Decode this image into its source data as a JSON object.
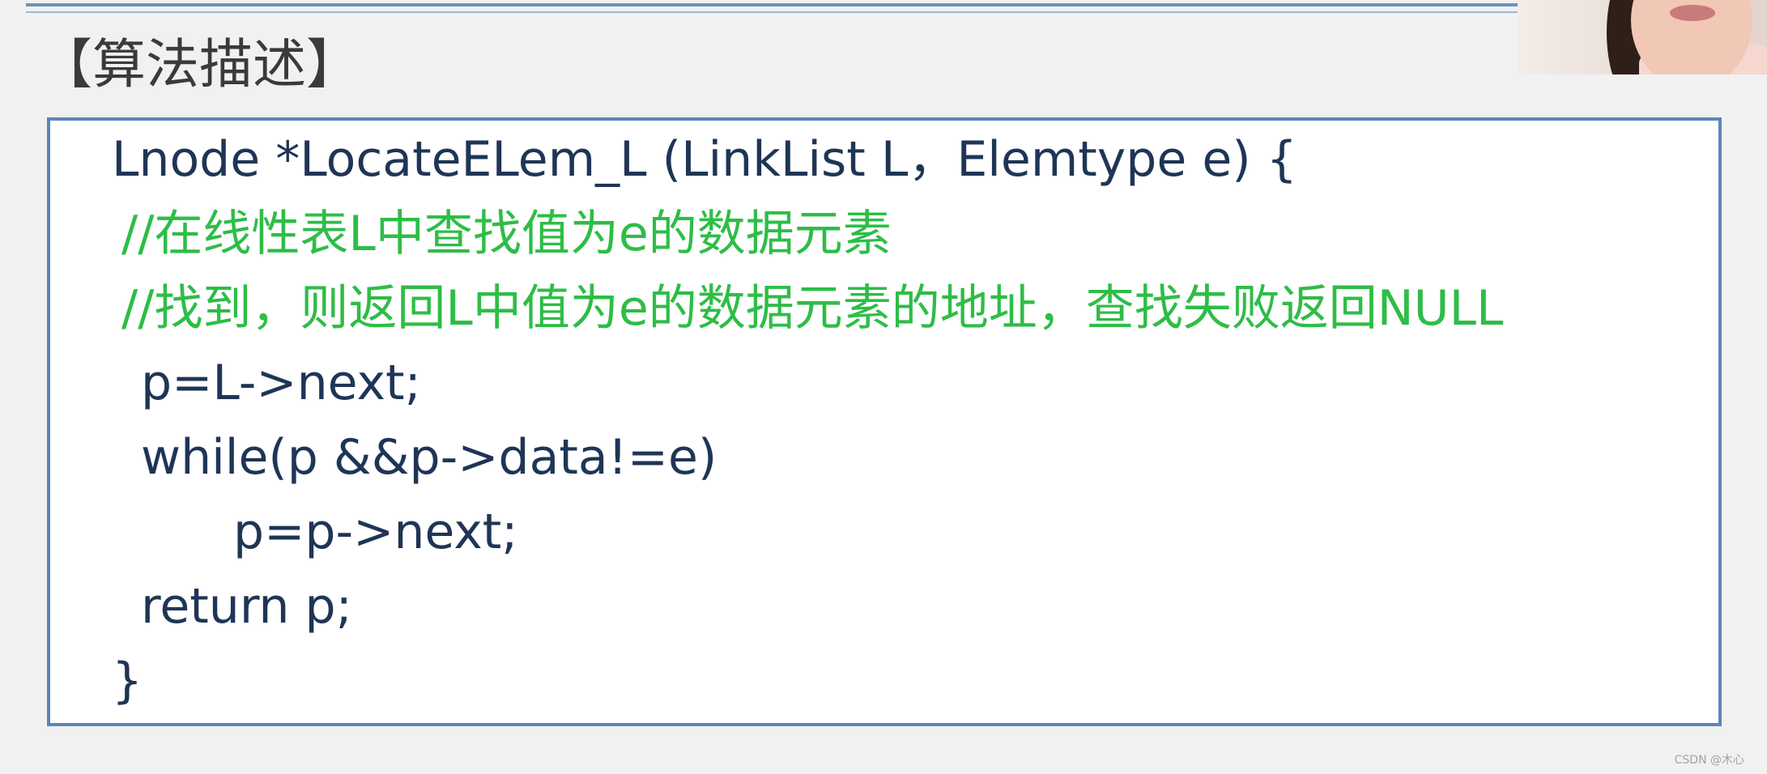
{
  "title": "【算法描述】",
  "code": {
    "signature": "Lnode *LocateELem_L (LinkList L，Elemtype e) {",
    "comment1": "//在线性表L中查找值为e的数据元素",
    "comment2": "//找到，则返回L中值为e的数据元素的地址，查找失败返回NULL",
    "line_p_init": "p=L->next;",
    "line_while": "while(p &&p->data!=e)",
    "line_advance": "p=p->next;",
    "line_return": "return p;",
    "line_close": "}"
  },
  "watermark": "CSDN @木心",
  "colors": {
    "code_text": "#1f3556",
    "comment_text": "#2ebd47",
    "box_border": "#5b86b8"
  }
}
